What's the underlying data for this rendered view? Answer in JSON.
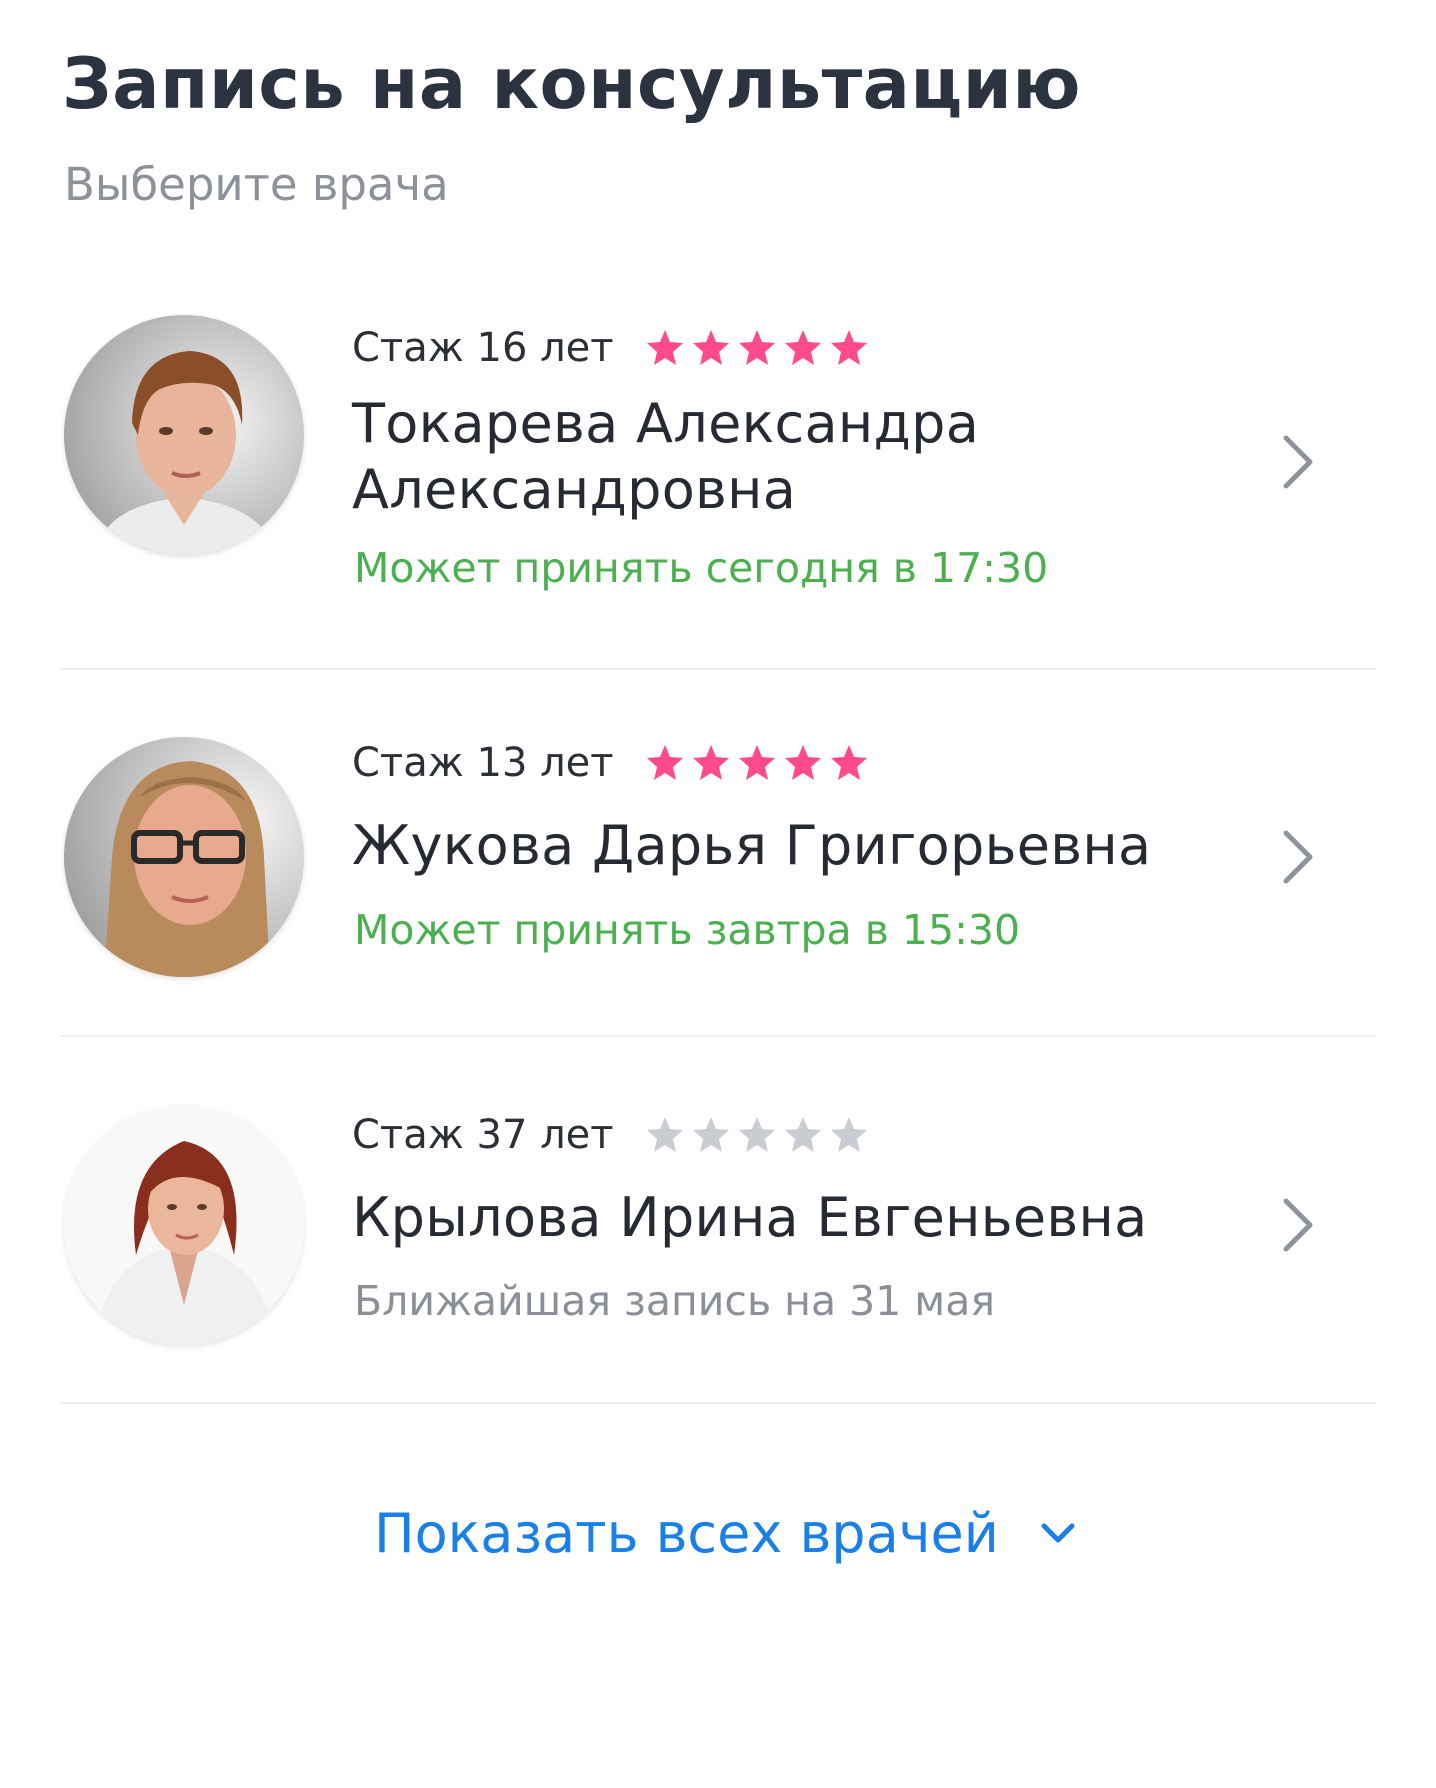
{
  "header": {
    "title": "Запись на консультацию",
    "subtitle": "Выберите врача"
  },
  "colors": {
    "star_filled": "#ff4a8d",
    "star_empty": "#c9ccd3",
    "available_green": "#4caf50",
    "muted_gray": "#8a8f98",
    "link_blue": "#1a7fe6",
    "chevron": "#8f949c"
  },
  "doctors": [
    {
      "experience": "Стаж 16 лет",
      "rating_stars": 5,
      "name": "Токарева Александра Александровна",
      "availability": "Может принять сегодня в 17:30",
      "availability_color": "#4caf50",
      "avatar_icon": "doctor-photo"
    },
    {
      "experience": "Стаж 13 лет",
      "rating_stars": 5,
      "name": "Жукова Дарья Григорьевна",
      "availability": "Может принять завтра в 15:30",
      "availability_color": "#4caf50",
      "avatar_icon": "doctor-photo"
    },
    {
      "experience": "Стаж 37 лет",
      "rating_stars": 0,
      "name": "Крылова Ирина Евгеньевна",
      "availability": "Ближайшая запись на 31 мая",
      "availability_color": "#8a8f98",
      "avatar_icon": "doctor-photo"
    }
  ],
  "footer": {
    "show_all_label": "Показать всех врачей",
    "show_all_icon": "chevron-down-icon"
  }
}
